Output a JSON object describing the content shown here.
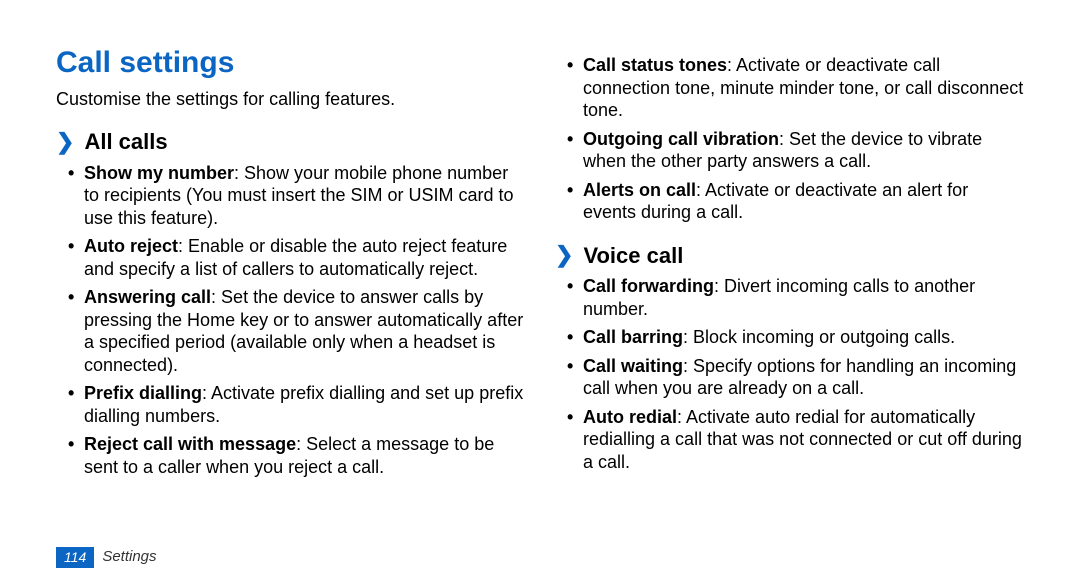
{
  "title": "Call settings",
  "intro": "Customise the settings for calling features.",
  "sections": [
    {
      "heading": "All calls",
      "items": [
        {
          "term": "Show my number",
          "desc": ": Show your mobile phone number to recipients (You must insert the SIM or USIM card to use this feature)."
        },
        {
          "term": "Auto reject",
          "desc": ": Enable or disable the auto reject feature and specify a list of callers to automatically reject."
        },
        {
          "term": "Answering call",
          "desc": ": Set the device to answer calls by pressing the Home key or to answer automatically after a specified period (available only when a headset is connected)."
        },
        {
          "term": "Prefix dialling",
          "desc": ": Activate prefix dialling and set up prefix dialling numbers."
        },
        {
          "term": "Reject call with message",
          "desc": ": Select a message to be sent to a caller when you reject a call."
        },
        {
          "term": "Call status tones",
          "desc": ": Activate or deactivate call connection tone, minute minder tone, or call disconnect tone."
        },
        {
          "term": "Outgoing call vibration",
          "desc": ": Set the device to vibrate when the other party answers a call."
        },
        {
          "term": "Alerts on call",
          "desc": ": Activate or deactivate an alert for events during a call."
        }
      ]
    },
    {
      "heading": "Voice call",
      "items": [
        {
          "term": "Call forwarding",
          "desc": ": Divert incoming calls to another number."
        },
        {
          "term": "Call barring",
          "desc": ": Block incoming or outgoing calls."
        },
        {
          "term": "Call waiting",
          "desc": ": Specify options for handling an incoming call when you are already on a call."
        },
        {
          "term": "Auto redial",
          "desc": ": Activate auto redial for automatically redialling a call that was not connected or cut off during a call."
        }
      ]
    }
  ],
  "page_number": "114",
  "footer_label": "Settings"
}
